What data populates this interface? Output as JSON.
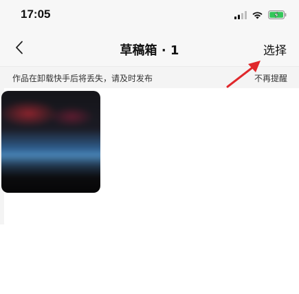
{
  "status_bar": {
    "time": "17:05",
    "icons": [
      "cellular-signal-icon",
      "wifi-icon",
      "battery-charging-icon"
    ]
  },
  "nav": {
    "back_icon": "chevron-left-icon",
    "title": "草稿箱 · 1",
    "select_label": "选择"
  },
  "notice": {
    "text": "作品在卸载快手后将丢失，请及时发布",
    "dismiss_label": "不再提醒"
  },
  "drafts": [
    {
      "thumbnail": "blurred-video-thumbnail"
    }
  ],
  "annotation": {
    "arrow_color": "#e0282c"
  },
  "colors": {
    "battery_green": "#34c759",
    "bar_background": "#f7f7f7"
  }
}
